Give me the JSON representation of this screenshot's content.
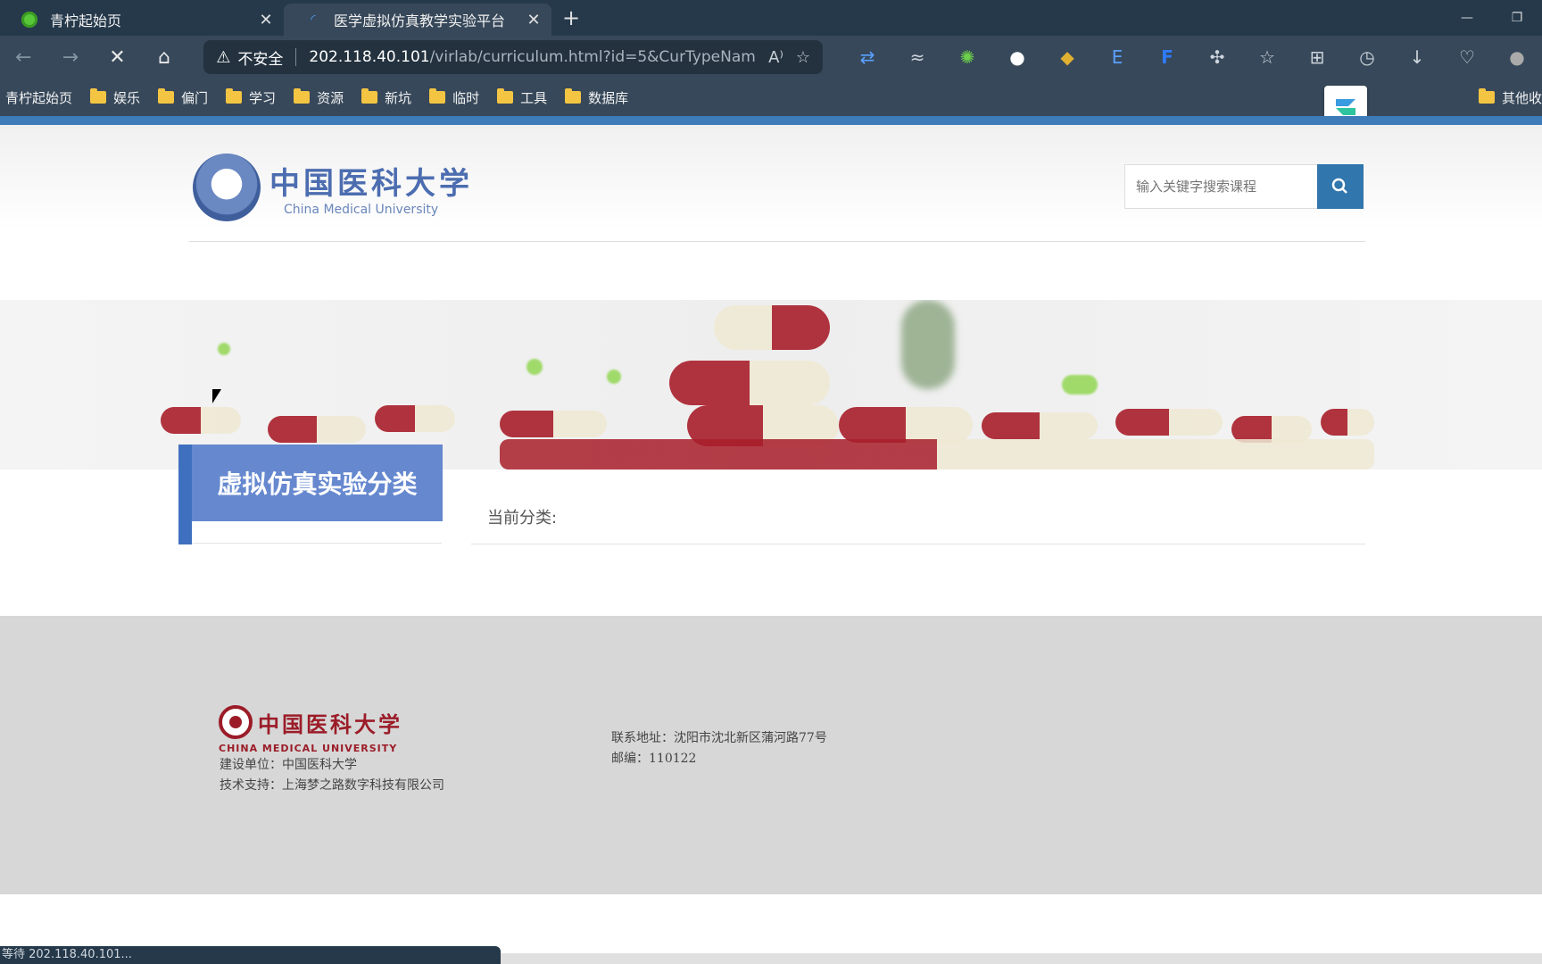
{
  "browser": {
    "tabs": [
      {
        "title": "青柠起始页",
        "active": false
      },
      {
        "title": "医学虚拟仿真教学实验平台",
        "active": true
      }
    ],
    "address": {
      "insecure_label": "不安全",
      "url_host": "202.118.40.101",
      "url_path": "/virlab/curriculum.html?id=5&CurTypeNam..."
    },
    "bookmarks": [
      "青柠起始页",
      "娱乐",
      "偏门",
      "学习",
      "资源",
      "新坑",
      "临时",
      "工具",
      "数据库"
    ],
    "other_bookmarks": "其他收",
    "status_text": "等待 202.118.40.101..."
  },
  "header": {
    "logo_cn": "中国医科大学",
    "logo_en": "China Medical University",
    "search_placeholder": "输入关键字搜索课程"
  },
  "category": {
    "title": "虚拟仿真实验分类",
    "current_label": "当前分类:"
  },
  "footer": {
    "logo_cn": "中国医科大学",
    "logo_en": "CHINA MEDICAL UNIVERSITY",
    "builder": "建设单位：中国医科大学",
    "support": "技术支持：上海梦之路数字科技有限公司",
    "address": "联系地址：沈阳市沈北新区蒲河路77号",
    "zip": "邮编：110122"
  },
  "colors": {
    "brand_blue": "#3176ad",
    "category_blue": "#6688cf",
    "footer_red": "#9b1c28"
  }
}
